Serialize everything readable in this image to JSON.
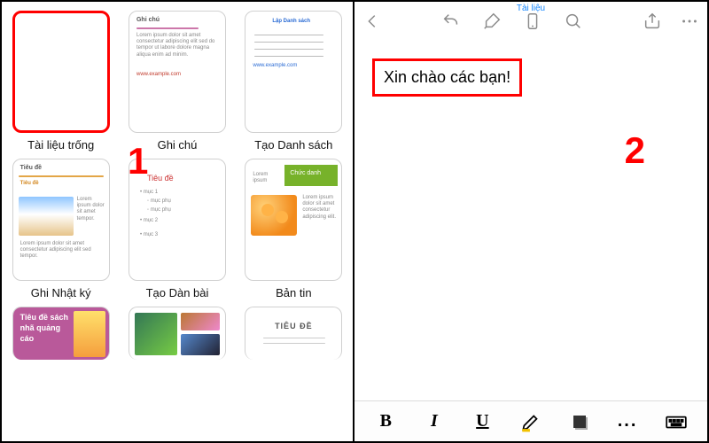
{
  "left": {
    "templates": [
      {
        "label": "Tài liệu trống"
      },
      {
        "label": "Ghi chú"
      },
      {
        "label": "Tạo Danh sách"
      },
      {
        "label": "Ghi Nhật ký"
      },
      {
        "label": "Tạo Dàn bài"
      },
      {
        "label": "Bản tin"
      }
    ],
    "row3": {
      "t0_line1": "Tiêu đề sách",
      "t0_line2": "nhã quảng",
      "t0_line3": "cáo",
      "t2_title": "TIÊU ĐỀ"
    },
    "callout": "1",
    "thumb_text": {
      "t1_title": "Ghi chú",
      "t2_title": "Lập Danh sách",
      "t3_title": "Tiêu đề",
      "t4_title": "Tiêu đề",
      "t5_title": "Chức danh"
    }
  },
  "right": {
    "crumb": "Tài liệu",
    "typed": "Xin chào các bạn!",
    "callout": "2",
    "format": {
      "bold": "B",
      "italic": "I",
      "underline": "U",
      "more": "..."
    }
  }
}
